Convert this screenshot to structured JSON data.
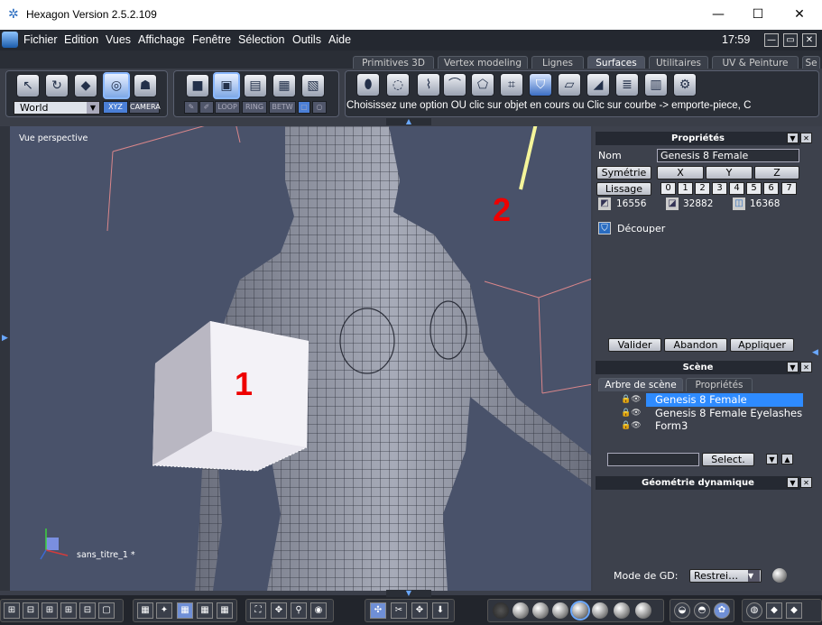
{
  "window": {
    "title": "Hexagon Version 2.5.2.109",
    "minimize": "—",
    "maximize": "☐",
    "close": "✕"
  },
  "menu": {
    "items": [
      "Fichier",
      "Edition",
      "Vues",
      "Affichage",
      "Fenêtre",
      "Sélection",
      "Outils",
      "Aide"
    ],
    "clock": "17:59"
  },
  "tabs": [
    {
      "label": "Primitives 3D",
      "active": false
    },
    {
      "label": "Vertex modeling",
      "active": false
    },
    {
      "label": "Lignes",
      "active": false
    },
    {
      "label": "Surfaces",
      "active": true
    },
    {
      "label": "Utilitaires",
      "active": false
    },
    {
      "label": "UV & Peinture",
      "active": false
    },
    {
      "label": "Se",
      "active": false
    }
  ],
  "toolbar": {
    "coord_system": "World",
    "xyz_label": "XYZ",
    "camera_label": "CAMERA",
    "loop_label": "LOOP",
    "ring_label": "RING",
    "betw_label": "BETW",
    "hint": "Choisissez une option OU clic sur objet en cours ou Clic sur courbe -> emporte-piece, C"
  },
  "viewport": {
    "label": "Vue perspective",
    "scene_file": "sans_titre_1 *",
    "annotation_1": "1",
    "annotation_2": "2",
    "annotation_color": "#e00000",
    "arrow_color": "#f5f59a"
  },
  "properties": {
    "title": "Propriétés",
    "name_label": "Nom",
    "name_value": "Genesis 8 Female",
    "symmetry_label": "Symétrie",
    "axes": [
      "X",
      "Y",
      "Z"
    ],
    "smoothing_label": "Lissage",
    "smoothing_levels": [
      "0",
      "1",
      "2",
      "3",
      "4",
      "5",
      "6",
      "7"
    ],
    "counts": [
      "16556",
      "32882",
      "16368"
    ],
    "tool_label": "Découper",
    "validate": "Valider",
    "cancel": "Abandon",
    "apply": "Appliquer"
  },
  "scene": {
    "title": "Scène",
    "tab_tree": "Arbre de scène",
    "tab_props": "Propriétés",
    "items": [
      {
        "label": "Genesis 8 Female",
        "selected": true
      },
      {
        "label": "Genesis 8 Female Eyelashes",
        "selected": false
      },
      {
        "label": "Form3",
        "selected": false
      }
    ],
    "select_button": "Select."
  },
  "dyn_geometry": {
    "title": "Géométrie dynamique",
    "mode_label": "Mode de GD:",
    "mode_value": "Restrei…"
  }
}
